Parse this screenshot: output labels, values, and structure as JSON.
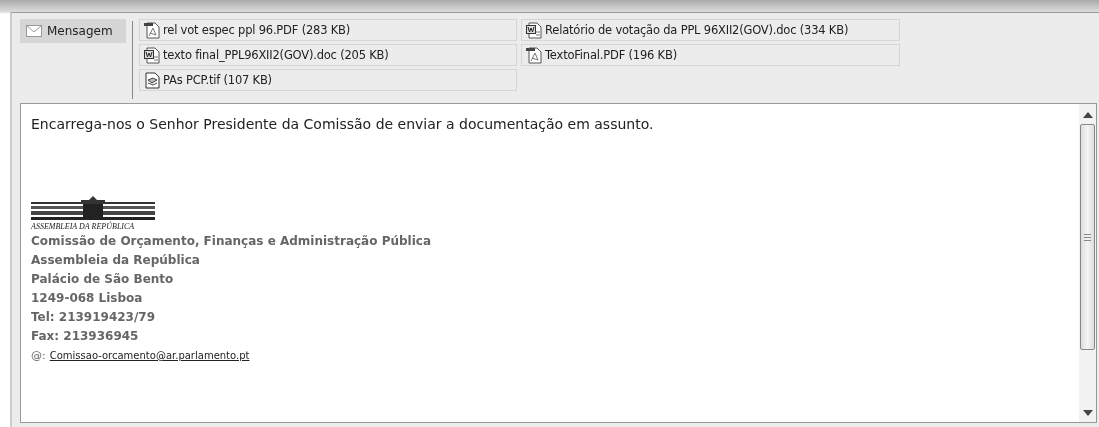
{
  "message_button": {
    "label": "Mensagem",
    "selected": true
  },
  "attachments": [
    {
      "kind": "pdf",
      "label": "rel vot espec ppl 96.PDF (283 KB)"
    },
    {
      "kind": "doc",
      "label": "Relatório de votação da PPL 96XII2(GOV).doc (334 KB)"
    },
    {
      "kind": "doc",
      "label": "texto final_PPL96XII2(GOV).doc (205 KB)"
    },
    {
      "kind": "pdf",
      "label": "TextoFinal.PDF (196 KB)"
    },
    {
      "kind": "tif",
      "label": "PAs PCP.tif (107 KB)"
    }
  ],
  "body": {
    "text": "Encarrega-nos o Senhor Presidente da Comissão de enviar a documentação em assunto.",
    "logo_text": "ASSEMBLEIA DA REPÚBLICA",
    "signature": [
      "Comissão de Orçamento, Finanças e Administração Pública",
      "Assembleia da República",
      "Palácio de São Bento",
      "1249-068 Lisboa",
      "Tel: 213919423/79",
      "Fax: 213936945"
    ],
    "email_label": "@:",
    "email": "Comissao-orcamento@ar.parlamento.pt"
  }
}
